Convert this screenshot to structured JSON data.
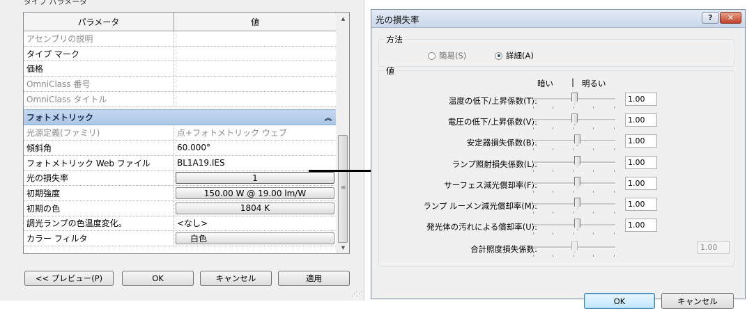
{
  "left": {
    "header": "タイプ パラメータ",
    "grid": {
      "col_param": "パラメータ",
      "col_value": "値",
      "rows_top": [
        {
          "name": "アセンブリの説明",
          "value": "",
          "dim": true
        },
        {
          "name": "タイプ マーク",
          "value": "",
          "dim": false
        },
        {
          "name": "価格",
          "value": "",
          "dim": false
        },
        {
          "name": "OmniClass 番号",
          "value": "",
          "dim": true
        },
        {
          "name": "OmniClass タイトル",
          "value": "",
          "dim": true
        }
      ],
      "group": {
        "label": "フォトメトリック",
        "chevron": "︽"
      },
      "rows_group": [
        {
          "name": "光源定義(ファミリ)",
          "value": "点+フォトメトリック ウェブ",
          "dim": true
        },
        {
          "name": "傾斜角",
          "value": "60.000°"
        },
        {
          "name": "フォトメトリック Web ファイル",
          "value": "BL1A19.IES"
        },
        {
          "name": "光の損失率",
          "value": "1"
        },
        {
          "name": "初期強度",
          "value": "150.00 W @ 19.00 lm/W"
        },
        {
          "name": "初期の色",
          "value": "1804 K"
        },
        {
          "name": "調光ランプの色温度変化。",
          "value": "<なし>"
        },
        {
          "name": "カラー フィルタ",
          "value": "白色"
        }
      ]
    },
    "scrollbar": {
      "up_arrow": "▲",
      "down_arrow": "▼",
      "grip": "≡"
    },
    "buttons": {
      "preview": "<< プレビュー(P)",
      "ok": "OK",
      "cancel": "キャンセル",
      "apply": "適用"
    }
  },
  "dialog": {
    "title": "光の損失率",
    "help_glyph": "?",
    "close_glyph": "✕",
    "method": {
      "label": "方法",
      "simple": "簡易(S)",
      "detailed": "詳細(A)",
      "selected": "detailed"
    },
    "values": {
      "label": "値",
      "dark_label": "暗い",
      "bright_label": "明るい",
      "rows": [
        {
          "label": "温度の低下/上昇係数(T):",
          "value": "1.00",
          "level": 0.5
        },
        {
          "label": "電圧の低下/上昇係数(V):",
          "value": "1.00",
          "level": 0.5
        },
        {
          "label": "安定器損失係数(B):",
          "value": "1.00",
          "level": 0.54
        },
        {
          "label": "ランプ照射損失係数(L):",
          "value": "1.00",
          "level": 0.54
        },
        {
          "label": "サーフェス減光償却率(F):",
          "value": "1.00",
          "level": 0.54
        },
        {
          "label": "ランプ ルーメン減光償却率(M):",
          "value": "1.00",
          "level": 0.54
        },
        {
          "label": "発光体の汚れによる償却率(U):",
          "value": "1.00",
          "level": 0.54
        }
      ],
      "total": {
        "label": "合計照度損失係数:",
        "value": "1.00",
        "level": 0.5
      }
    },
    "buttons": {
      "ok": "OK",
      "cancel": "キャンセル"
    }
  }
}
